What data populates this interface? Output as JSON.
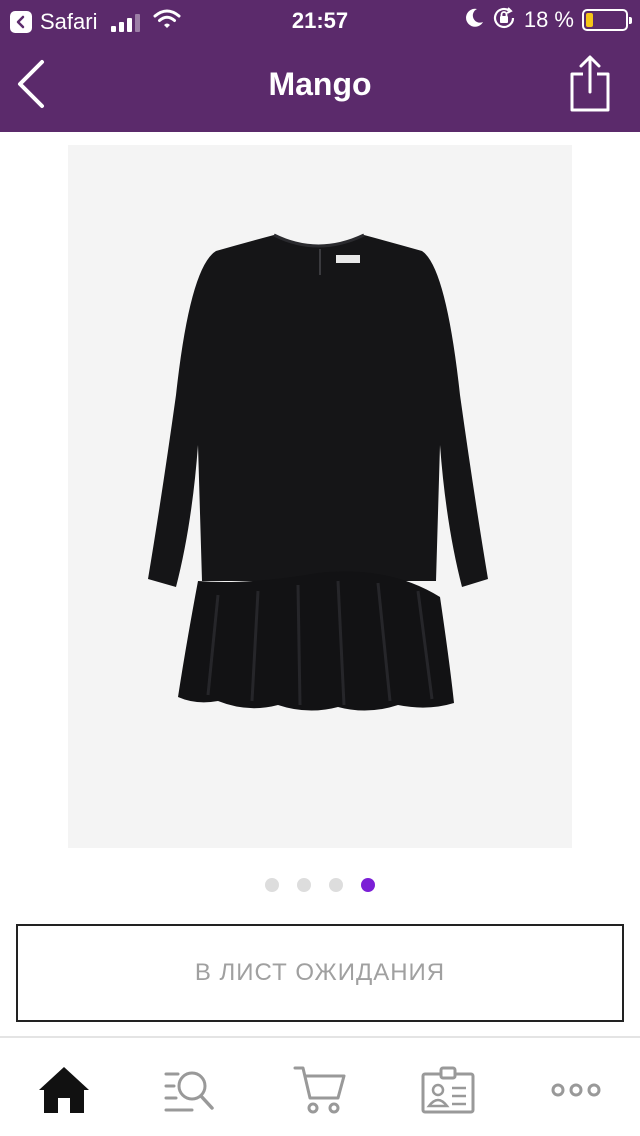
{
  "status_bar": {
    "back_app": "Safari",
    "time": "21:57",
    "battery_percent": "18 %",
    "battery_level": 0.18,
    "battery_color": "#f5c518"
  },
  "navbar": {
    "title": "Mango",
    "background": "#5b2a6b",
    "back_icon": "chevron-left-icon",
    "share_icon": "share-icon"
  },
  "product": {
    "image": "black-long-sleeve-ruffle-dress",
    "carousel": {
      "total": 4,
      "active_index": 4,
      "active_color": "#7b1fd6"
    }
  },
  "actions": {
    "waitlist_label": "В ЛИСТ ОЖИДАНИЯ"
  },
  "tabbar": {
    "items": [
      {
        "icon": "home-icon",
        "active": true
      },
      {
        "icon": "search-icon",
        "active": false
      },
      {
        "icon": "cart-icon",
        "active": false
      },
      {
        "icon": "profile-card-icon",
        "active": false
      },
      {
        "icon": "more-icon",
        "active": false
      }
    ]
  }
}
